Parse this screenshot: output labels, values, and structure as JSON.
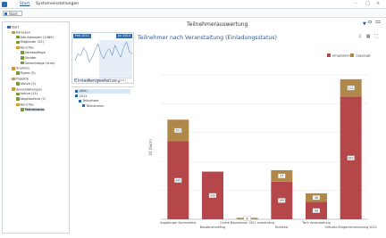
{
  "menu": {
    "start": "Start",
    "settings": "Systemeinstellungen"
  },
  "breadcrumb": {
    "label": "Start"
  },
  "tree": [
    {
      "label": "Start",
      "depth": 0,
      "color": "#2b6cb0",
      "expander": "−"
    },
    {
      "label": "Adressen",
      "depth": 1,
      "color": "#d59b2a",
      "expander": "−"
    },
    {
      "label": "Alle Adressen (1489)",
      "depth": 2,
      "color": "#7a9a3a",
      "expander": ""
    },
    {
      "label": "Mitglieder (25)",
      "depth": 2,
      "color": "#7a9a3a",
      "expander": ""
    },
    {
      "label": "Berichte",
      "depth": 2,
      "color": "#d59b2a",
      "expander": "−"
    },
    {
      "label": "Adresspflege",
      "depth": 3,
      "color": "#7a9a3a",
      "expander": ""
    },
    {
      "label": "Gender",
      "depth": 3,
      "color": "#7a9a3a",
      "expander": ""
    },
    {
      "label": "Geburtstage (kurz)",
      "depth": 3,
      "color": "#7a9a3a",
      "expander": ""
    },
    {
      "label": "Gremien",
      "depth": 1,
      "color": "#d59b2a",
      "expander": "−"
    },
    {
      "label": "Figaro (5)",
      "depth": 2,
      "color": "#7a9a3a",
      "expander": ""
    },
    {
      "label": "Projekte",
      "depth": 1,
      "color": "#d59b2a",
      "expander": "−"
    },
    {
      "label": "Aktive (2)",
      "depth": 2,
      "color": "#7a9a3a",
      "expander": ""
    },
    {
      "label": "Veranstaltungen",
      "depth": 1,
      "color": "#d59b2a",
      "expander": "−"
    },
    {
      "label": "Aktive (11)",
      "depth": 2,
      "color": "#7a9a3a",
      "expander": ""
    },
    {
      "label": "Abgelaufene (1)",
      "depth": 2,
      "color": "#7a9a3a",
      "expander": ""
    },
    {
      "label": "Berichte",
      "depth": 2,
      "color": "#d59b2a",
      "expander": "−"
    },
    {
      "label": "Teilnehmer",
      "depth": 3,
      "color": "#7a9a3a",
      "expander": "",
      "selected": true
    }
  ],
  "timeline": {
    "start_badge": "Feb 2011",
    "end_badge": "Jul 2013",
    "dates": [
      "1.7.2011",
      "1.1.2012",
      "1.7.2012"
    ],
    "trend": [
      20,
      28,
      26,
      35,
      30,
      18,
      24,
      32,
      40,
      28,
      22,
      30,
      34,
      26,
      38,
      30,
      24,
      36,
      42,
      30,
      28
    ]
  },
  "filter": {
    "title": "Einladungsstatus",
    "dropdown_icon": "▾",
    "expand_icon": "⛶",
    "rows": [
      {
        "label": "(Alle)",
        "checked": true,
        "indent": 0,
        "highlight": true
      },
      {
        "label": "2011",
        "checked": true,
        "indent": 0
      },
      {
        "label": "Teilnahme",
        "checked": true,
        "indent": 1
      },
      {
        "label": "Teilnahmen",
        "checked": true,
        "indent": 2
      }
    ]
  },
  "pane": {
    "title": "Teilnehmerauswertung",
    "filter_icon": "▼"
  },
  "chart_title": "Teilnehmer nach Veranstaltung (Einladungsstatus)",
  "chart_tools": [
    "⇩",
    "▦",
    "⛶"
  ],
  "colors": {
    "accent": "#2b579a",
    "bar_red": "#b5474b",
    "bar_gold": "#b0894a",
    "selection": "#d7e6f5"
  },
  "chart_data": {
    "type": "bar",
    "stacked": true,
    "ylabel": "ID (Sum)",
    "ylim": [
      0,
      1000
    ],
    "categories": [
      "Augsburger Sommerfest",
      "Bauabnahmeflug",
      "Online Bauseminar 2011 eventrating",
      "Richtfest",
      "Tech Veranstaltung",
      "Virtuelle Bürgerversammlung 2012"
    ],
    "series": [
      {
        "name": "eingeladen",
        "color": "#b5474b",
        "values": [
          540,
          330,
          0,
          260,
          120,
          850
        ]
      },
      {
        "name": "zugesagt",
        "color": "#b0894a",
        "values": [
          150,
          0,
          10,
          80,
          60,
          120
        ]
      }
    ],
    "data_labels": {
      "eingeladen": [
        "345",
        "339",
        "",
        "199",
        "98",
        "643"
      ],
      "zugesagt": [
        "151",
        "",
        "6",
        "37",
        "48",
        "121"
      ]
    },
    "legend_position": "top-right",
    "grid": true
  }
}
